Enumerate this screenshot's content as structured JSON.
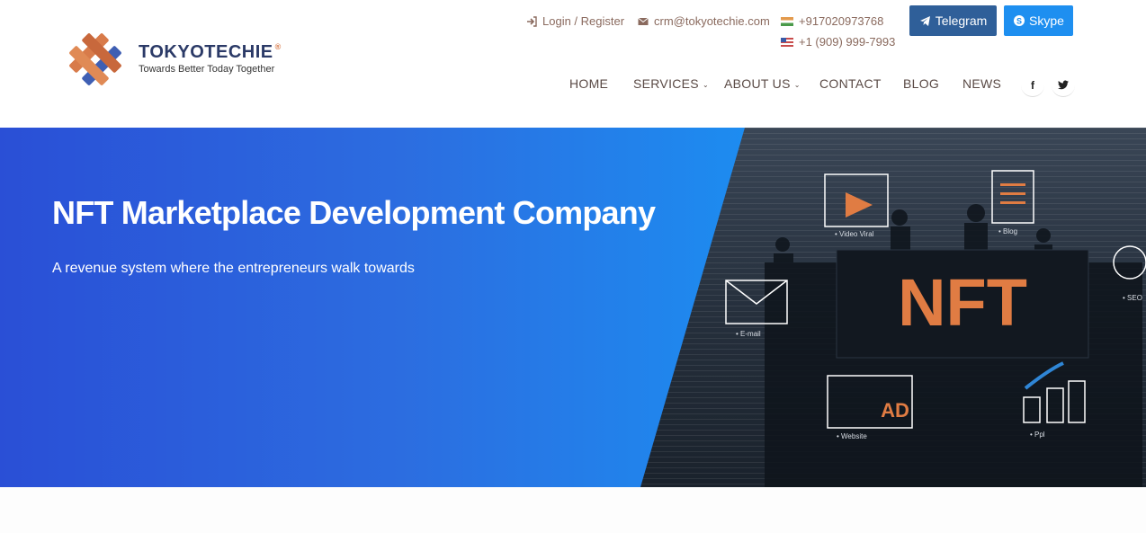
{
  "logo": {
    "name_part1": "TOKYO",
    "name_part2": "TECHIE",
    "reg_mark": "®",
    "tagline": "Towards Better Today Together"
  },
  "topbar": {
    "login_label": "Login / Register",
    "login_icon": "sign-in-icon",
    "email": "crm@tokyotechie.com",
    "email_icon": "envelope-icon",
    "phone_india": "+917020973768",
    "phone_us": "+1 (909) 999-7993"
  },
  "buttons": {
    "telegram_label": "Telegram",
    "skype_label": "Skype"
  },
  "nav": {
    "items": [
      {
        "label": "HOME"
      },
      {
        "label": "SERVICES"
      },
      {
        "label": "ABOUT US"
      },
      {
        "label": "CONTACT"
      },
      {
        "label": "BLOG"
      },
      {
        "label": "NEWS"
      }
    ],
    "facebook": "f",
    "twitter": "twitter-icon"
  },
  "hero": {
    "title": "NFT Marketplace Development Company",
    "subtitle": "A revenue system where the entrepreneurs walk towards",
    "graphic": {
      "nft_label": "NFT",
      "ad_label": "AD",
      "video_label": "• Video Viral",
      "blog_label": "• Blog",
      "email_label": "• E-mail",
      "seo_label": "• SEO",
      "website_label": "• Website",
      "ppc_label": "• Ppl"
    }
  },
  "colors": {
    "brand_navy": "#2b3a67",
    "brand_orange": "#d87b4a",
    "telegram_bg": "#2f5f99",
    "skype_bg": "#1e8ff0",
    "hero_blue": "#1d8cf0"
  }
}
